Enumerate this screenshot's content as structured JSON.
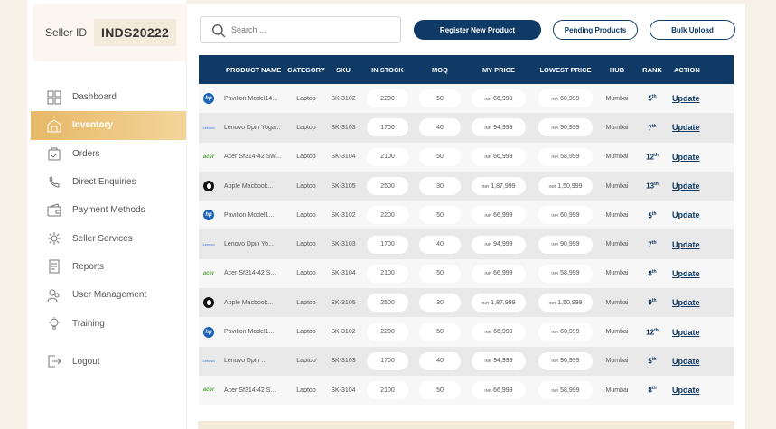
{
  "seller": {
    "label": "Seller ID",
    "id": "INDS20222"
  },
  "nav": [
    {
      "label": "Dashboard",
      "icon": "dashboard-icon",
      "active": false
    },
    {
      "label": "Inventory",
      "icon": "inventory-icon",
      "active": true
    },
    {
      "label": "Orders",
      "icon": "orders-icon",
      "active": false
    },
    {
      "label": "Direct Enquiries",
      "icon": "enquiries-icon",
      "active": false
    },
    {
      "label": "Payment Methods",
      "icon": "payment-icon",
      "active": false
    },
    {
      "label": "Seller Services",
      "icon": "services-icon",
      "active": false
    },
    {
      "label": "Reports",
      "icon": "reports-icon",
      "active": false
    },
    {
      "label": "User Management",
      "icon": "users-icon",
      "active": false
    },
    {
      "label": "Training",
      "icon": "training-icon",
      "active": false
    }
  ],
  "logout": {
    "label": "Logout",
    "icon": "logout-icon"
  },
  "search": {
    "placeholder": "Search ..."
  },
  "buttons": {
    "register": "Register New Product",
    "pending": "Pending Products",
    "bulk": "Bulk Upload"
  },
  "colors": {
    "primary": "#0f3a66",
    "accent": "#e7b867"
  },
  "table": {
    "headers": {
      "name": "PRODUCT NAME",
      "category": "CATEGORY",
      "sku": "SKU",
      "stock": "IN STOCK",
      "moq": "MOQ",
      "price": "MY PRICE",
      "lowest": "LOWEST PRICE",
      "hub": "HUB",
      "rank": "RANK",
      "action": "ACTION"
    },
    "currency": "INR",
    "rows": [
      {
        "logo": "hp",
        "name": "Pavilion Model14...",
        "category": "Laptop",
        "sku": "SK-3102",
        "stock": "2200",
        "moq": "50",
        "price": "66,999",
        "lowest": "60,999",
        "hub": "Mumbai",
        "rank": "5",
        "rank_suffix": "th",
        "action": "Update"
      },
      {
        "logo": "lenovo",
        "name": "Lenovo Dpin Yoga...",
        "category": "Laptop",
        "sku": "SK-3103",
        "stock": "1700",
        "moq": "40",
        "price": "94,999",
        "lowest": "90,999",
        "hub": "Mumbai",
        "rank": "7",
        "rank_suffix": "th",
        "action": "Update"
      },
      {
        "logo": "acer",
        "name": "Acer Sf314-42 Swi...",
        "category": "Laptop",
        "sku": "SK-3104",
        "stock": "2100",
        "moq": "50",
        "price": "66,999",
        "lowest": "58,999",
        "hub": "Mumbai",
        "rank": "12",
        "rank_suffix": "th",
        "action": "Update"
      },
      {
        "logo": "apple",
        "name": "Apple Macbook...",
        "category": "Laptop",
        "sku": "SK-3105",
        "stock": "2500",
        "moq": "30",
        "price": "1,87,999",
        "lowest": "1,50,999",
        "hub": "Mumbai",
        "rank": "13",
        "rank_suffix": "th",
        "action": "Update"
      },
      {
        "logo": "hp",
        "name": "Pavilion Model1...",
        "category": "Laptop",
        "sku": "SK-3102",
        "stock": "2200",
        "moq": "50",
        "price": "66,999",
        "lowest": "60,999",
        "hub": "Mumbai",
        "rank": "5",
        "rank_suffix": "th",
        "action": "Update"
      },
      {
        "logo": "lenovo",
        "name": "Lenovo Dpin Yo...",
        "category": "Laptop",
        "sku": "SK-3103",
        "stock": "1700",
        "moq": "40",
        "price": "94,999",
        "lowest": "90,999",
        "hub": "Mumbai",
        "rank": "7",
        "rank_suffix": "th",
        "action": "Update"
      },
      {
        "logo": "acer",
        "name": "Acer Sf314-42 S...",
        "category": "Laptop",
        "sku": "SK-3104",
        "stock": "2100",
        "moq": "50",
        "price": "66,999",
        "lowest": "58,999",
        "hub": "Mumbai",
        "rank": "8",
        "rank_suffix": "th",
        "action": "Update"
      },
      {
        "logo": "apple",
        "name": "Apple Macbook...",
        "category": "Laptop",
        "sku": "SK-3105",
        "stock": "2500",
        "moq": "30",
        "price": "1,87,999",
        "lowest": "1,50,999",
        "hub": "Mumbai",
        "rank": "9",
        "rank_suffix": "th",
        "action": "Update"
      },
      {
        "logo": "hp",
        "name": "Pavilion Model1...",
        "category": "Laptop",
        "sku": "SK-3102",
        "stock": "2200",
        "moq": "50",
        "price": "66,999",
        "lowest": "60,999",
        "hub": "Mumbai",
        "rank": "12",
        "rank_suffix": "th",
        "action": "Update"
      },
      {
        "logo": "lenovo",
        "name": "Lenovo Dpin ...",
        "category": "Laptop",
        "sku": "SK-3103",
        "stock": "1700",
        "moq": "40",
        "price": "94,999",
        "lowest": "90,999",
        "hub": "Mumbai",
        "rank": "5",
        "rank_suffix": "th",
        "action": "Update"
      },
      {
        "logo": "acer",
        "name": "Acer Sf314-42 S...",
        "category": "Laptop",
        "sku": "SK-3104",
        "stock": "2100",
        "moq": "50",
        "price": "66,999",
        "lowest": "58,999",
        "hub": "Mumbai",
        "rank": "8",
        "rank_suffix": "th",
        "action": "Update"
      }
    ]
  }
}
